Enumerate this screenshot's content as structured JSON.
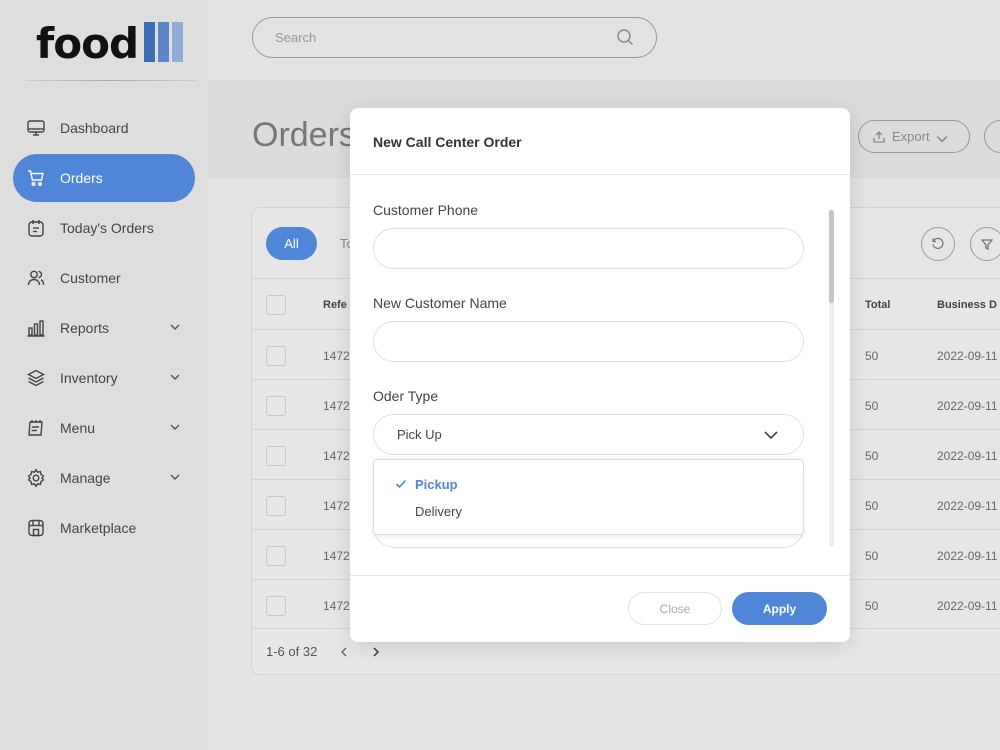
{
  "brand": {
    "logo_text": "food"
  },
  "search": {
    "placeholder": "Search"
  },
  "sidebar": {
    "items": [
      {
        "label": "Dashboard",
        "icon": "monitor-icon"
      },
      {
        "label": "Orders",
        "icon": "cart-icon",
        "active": true
      },
      {
        "label": "Today's Orders",
        "icon": "calendar-icon"
      },
      {
        "label": "Customer",
        "icon": "users-icon"
      },
      {
        "label": "Reports",
        "icon": "bar-chart-icon",
        "expandable": true
      },
      {
        "label": "Inventory",
        "icon": "layers-icon",
        "expandable": true
      },
      {
        "label": "Menu",
        "icon": "menu-card-icon",
        "expandable": true
      },
      {
        "label": "Manage",
        "icon": "gear-icon",
        "expandable": true
      },
      {
        "label": "Marketplace",
        "icon": "store-icon"
      }
    ]
  },
  "page": {
    "title": "Orders",
    "export_label": "Export"
  },
  "filters": {
    "all_label": "All",
    "second_label_partial": "To"
  },
  "table": {
    "headers": {
      "reference": "Refe",
      "total": "Total",
      "business_date": "Business D"
    },
    "rows": [
      {
        "reference": "1472",
        "total": "50",
        "business_date": "2022-09-11"
      },
      {
        "reference": "1472",
        "total": "50",
        "business_date": "2022-09-11"
      },
      {
        "reference": "1472",
        "total": "50",
        "business_date": "2022-09-11"
      },
      {
        "reference": "1472",
        "total": "50",
        "business_date": "2022-09-11"
      },
      {
        "reference": "1472",
        "total": "50",
        "business_date": "2022-09-11"
      },
      {
        "reference": "1472",
        "total": "50",
        "business_date": "2022-09-11"
      }
    ]
  },
  "pagination": {
    "label": "1-6 of 32"
  },
  "modal": {
    "title": "New Call Center Order",
    "customer_phone_label": "Customer Phone",
    "customer_phone_value": "",
    "customer_name_label": "New Customer Name",
    "customer_name_value": "",
    "order_type_label": "Oder Type",
    "order_type_value": "Pick Up",
    "order_type_options": [
      {
        "label": "Pickup",
        "selected": true
      },
      {
        "label": "Delivery",
        "selected": false
      }
    ],
    "close_label": "Close",
    "apply_label": "Apply"
  },
  "colors": {
    "accent": "#4f86d8",
    "logo_bar_dark": "#3d6db5",
    "logo_bar_mid": "#5b87c8",
    "logo_bar_light": "#8fadd9"
  }
}
